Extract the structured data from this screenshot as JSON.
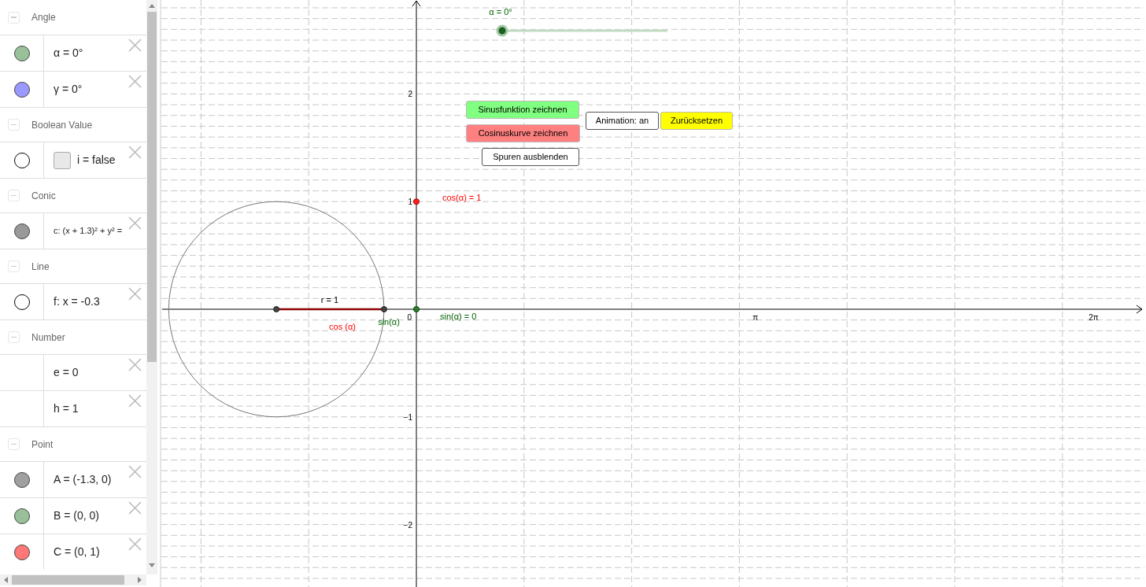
{
  "algebra": {
    "groups": [
      {
        "label": "Angle",
        "expanded": true,
        "items": [
          {
            "kind": "object",
            "shown": true,
            "color": "#99c199",
            "text": "α = 0°"
          },
          {
            "kind": "object",
            "shown": true,
            "color": "#9999ff",
            "text": "γ = 0°"
          }
        ]
      },
      {
        "label": "Boolean Value",
        "expanded": true,
        "items": [
          {
            "kind": "boolean",
            "shown": false,
            "checked": false,
            "text": "i = false"
          }
        ]
      },
      {
        "label": "Conic",
        "expanded": true,
        "items": [
          {
            "kind": "object",
            "shown": true,
            "color": "#999999",
            "text": "c: (x + 1.3)² + y² ="
          }
        ]
      },
      {
        "label": "Line",
        "expanded": true,
        "items": [
          {
            "kind": "object",
            "shown": false,
            "text": "f: x = -0.3"
          }
        ]
      },
      {
        "label": "Number",
        "expanded": true,
        "items": [
          {
            "kind": "number",
            "text": "e = 0"
          },
          {
            "kind": "number",
            "text": "h = 1"
          }
        ]
      },
      {
        "label": "Point",
        "expanded": true,
        "items": [
          {
            "kind": "object",
            "shown": true,
            "color": "#a0a0a0",
            "text": "A = (-1.3, 0)"
          },
          {
            "kind": "object",
            "shown": true,
            "color": "#99c199",
            "text": "B = (0, 0)"
          },
          {
            "kind": "object",
            "shown": true,
            "color": "#ff7777",
            "text": "C = (0, 1)"
          }
        ]
      }
    ]
  },
  "graphics": {
    "y_ticks": [
      "2",
      "1",
      "−1",
      "−2"
    ],
    "x_ticks": [
      "π",
      "2π"
    ],
    "origin_label": "0",
    "slider": {
      "label": "α = 0°",
      "level": 0
    },
    "labels": [
      {
        "kind": "cos_value",
        "text": "cos(α) = 1"
      },
      {
        "kind": "radius",
        "text": "r = 1"
      },
      {
        "kind": "sin_value",
        "text": "sin(α) = 0"
      },
      {
        "kind": "sin",
        "text": "sin(α)"
      },
      {
        "kind": "cos",
        "text": "cos (α)"
      }
    ],
    "buttons": [
      {
        "kind": "sine",
        "text": "Sinusfunktion zeichnen",
        "color": "#80ff80"
      },
      {
        "kind": "cosine",
        "text": "Cosinuskurve zeichnen",
        "color": "#ff8080"
      },
      {
        "kind": "animation",
        "text": "Animation: an",
        "color": "#ffffff"
      },
      {
        "kind": "reset",
        "text": "Zurücksetzen",
        "color": "#ffff00"
      },
      {
        "kind": "traces",
        "text": "Spuren ausblenden",
        "color": "#ffffff"
      }
    ]
  }
}
